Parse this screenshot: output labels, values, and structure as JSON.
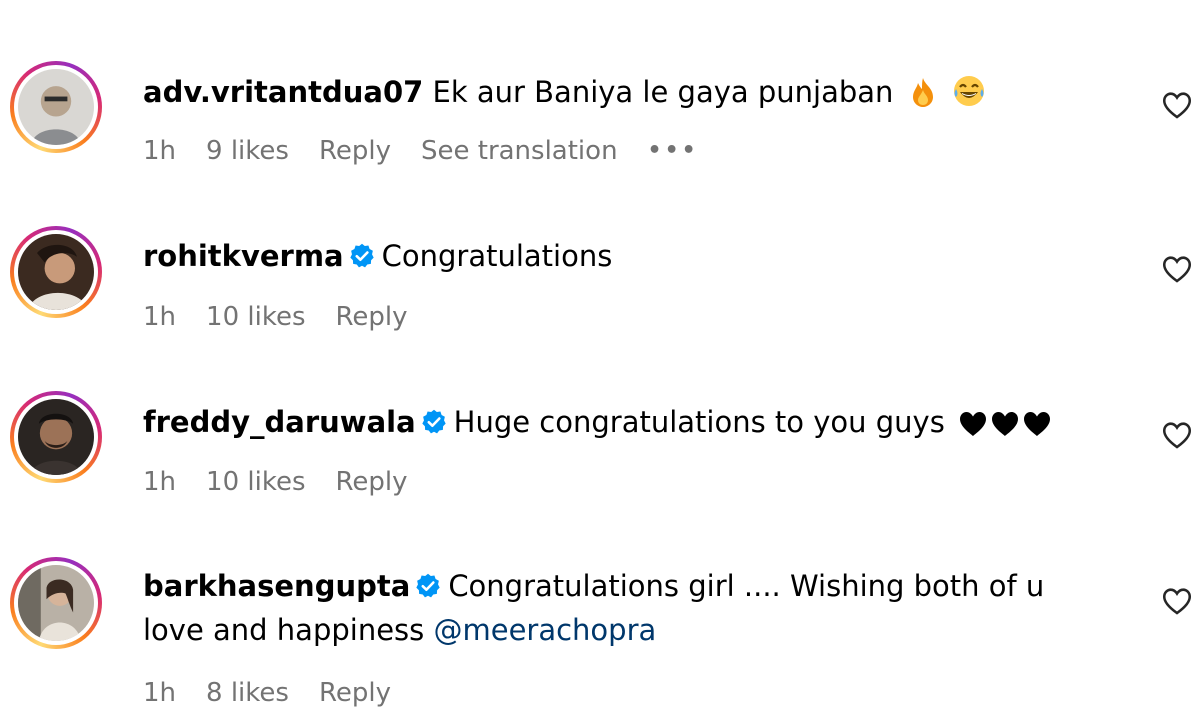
{
  "comments": [
    {
      "username": "adv.vritantdua07",
      "verified": false,
      "text": "Ek aur Baniya le gaya punjaban",
      "emojis": [
        "fire-emoji",
        "tears-of-joy-emoji"
      ],
      "time": "1h",
      "likes": "9 likes",
      "reply": "Reply",
      "translation": "See translation",
      "more": "•••"
    },
    {
      "username": "rohitkverma",
      "verified": true,
      "text": "Congratulations",
      "time": "1h",
      "likes": "10 likes",
      "reply": "Reply"
    },
    {
      "username": "freddy_daruwala",
      "verified": true,
      "text": "Huge congratulations to you guys",
      "emojis": [
        "black-heart-emoji",
        "black-heart-emoji",
        "black-heart-emoji"
      ],
      "time": "1h",
      "likes": "10 likes",
      "reply": "Reply"
    },
    {
      "username": "barkhasengupta",
      "verified": true,
      "text": "Congratulations girl .... Wishing both of u love and happiness",
      "mention": "@meerachopra",
      "time": "1h",
      "likes": "8 likes",
      "reply": "Reply"
    }
  ],
  "colors": {
    "text": "#000000",
    "meta": "#737373",
    "verified": "#0095f6",
    "mention": "#00376b"
  },
  "icons": {
    "like": "heart-outline-icon",
    "verified": "verified-badge-icon"
  }
}
